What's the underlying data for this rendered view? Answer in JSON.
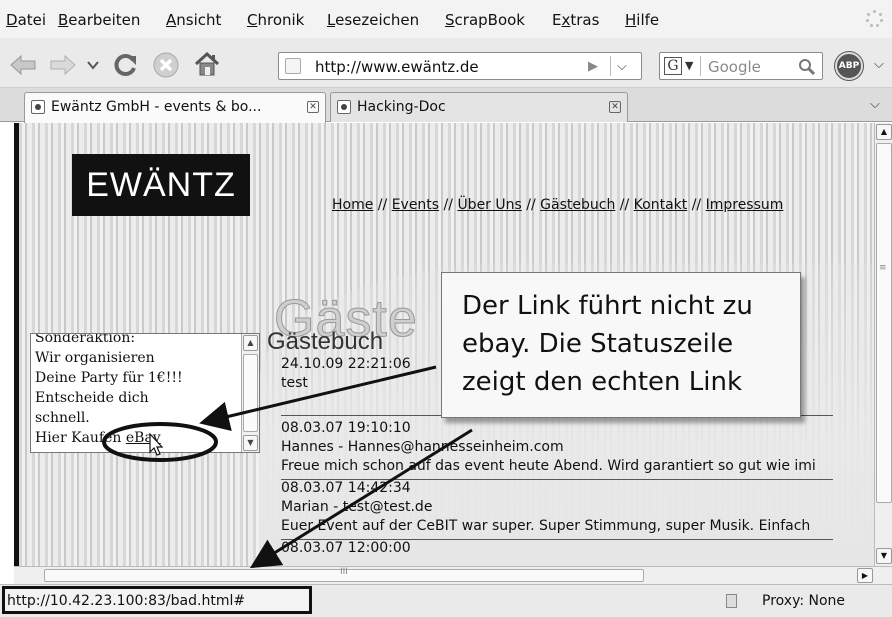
{
  "menu": {
    "items": [
      {
        "accel": "D",
        "rest": "atei"
      },
      {
        "accel": "B",
        "rest": "earbeiten"
      },
      {
        "accel": "A",
        "rest": "nsicht"
      },
      {
        "accel": "C",
        "rest": "hronik"
      },
      {
        "accel": "L",
        "rest": "esezeichen"
      },
      {
        "accel": "S",
        "rest": "crapBook"
      },
      {
        "pre": "E",
        "accel": "x",
        "rest": "tras"
      },
      {
        "accel": "H",
        "rest": "ilfe"
      }
    ]
  },
  "toolbar": {
    "icons": [
      "back-icon",
      "forward-icon",
      "history-dropdown-icon",
      "reload-icon",
      "stop-icon",
      "home-icon"
    ],
    "url": "http://www.ewäntz.de",
    "search_placeholder": "Google",
    "adblock_label": "ABP"
  },
  "tabs": [
    {
      "title": "Ewäntz GmbH - events & bo...",
      "active": true
    },
    {
      "title": "Hacking-Doc",
      "active": false
    }
  ],
  "page": {
    "logo": "EWÄNTZ",
    "nav": [
      "Home",
      "Events",
      "Über Uns",
      "Gästebuch",
      "Kontakt",
      "Impressum"
    ],
    "nav_separator": " // ",
    "big_title": "Gäste",
    "small_title": "Gästebuch",
    "entries": [
      {
        "date": "24.10.09 22:21:06",
        "author": "",
        "message": "test"
      },
      {
        "date": "08.03.07 19:10:10",
        "author": "Hannes  -  Hannes@hannesseinheim.com",
        "message": "Freue mich schon auf das event heute Abend. Wird garantiert so gut wie imi"
      },
      {
        "date": "08.03.07 14:42:34",
        "author": "Marian  -  test@test.de",
        "message": "Euer Event auf der CeBIT war super. Super Stimmung, super Musik. Einfach"
      },
      {
        "date": "08.03.07 12:00:00",
        "author": "",
        "message": ""
      }
    ],
    "ad": {
      "top_cut": "Sonderaktion:",
      "lines": [
        "Wir organisieren",
        "Deine Party für 1€!!!",
        "Entscheide dich",
        "schnell."
      ],
      "link_prefix": "Hier Kaufen ",
      "link_text": "eBay"
    }
  },
  "callout": {
    "lines": [
      "Der Link führt nicht zu",
      "ebay. Die Statuszeile",
      "zeigt den echten Link"
    ]
  },
  "statusbar": {
    "link": "http://10.42.23.100:83/bad.html#",
    "proxy": "Proxy: None"
  },
  "colors": {
    "annotation": "#111111",
    "callout_bg": "#f8f8f8",
    "logo_bg": "#111111"
  }
}
